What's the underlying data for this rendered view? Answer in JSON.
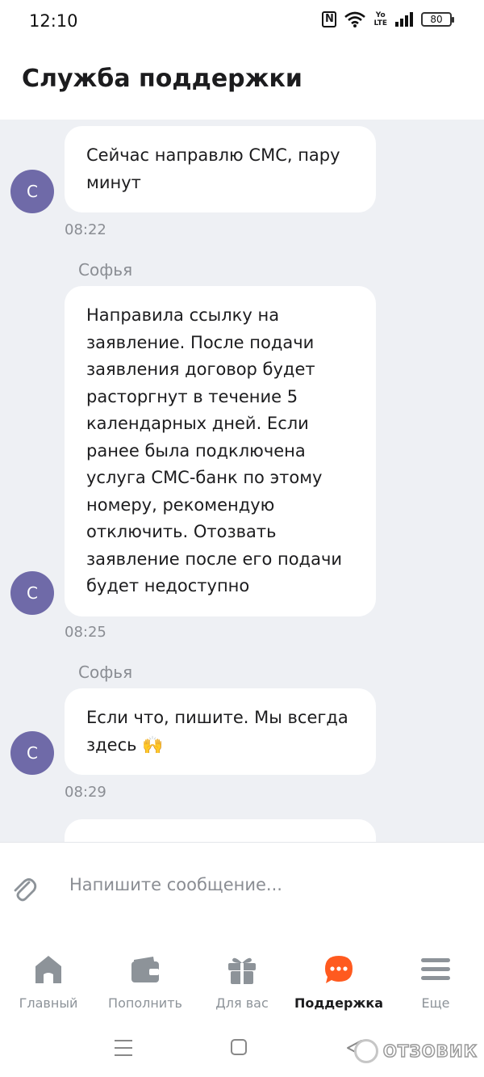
{
  "status_bar": {
    "time": "12:10",
    "volte_top": "Yo",
    "volte_bottom": "LTE",
    "battery": "80"
  },
  "header": {
    "title": "Служба поддержки"
  },
  "messages": [
    {
      "sender": "",
      "avatar": "С",
      "text": "Сейчас направлю СМС, пару минут",
      "time": "08:22"
    },
    {
      "sender": "Софья",
      "avatar": "С",
      "text": "Направила ссылку на заявление. После подачи заявления договор будет расторгнут в течение 5 календарных дней. Если ранее была подключена услуга СМС-банк по этому номеру, рекомендую отключить. Отозвать заявление после его подачи будет недоступно",
      "time": "08:25"
    },
    {
      "sender": "Софья",
      "avatar": "С",
      "text": "Если что, пишите. Мы всегда здесь 🙌",
      "time": "08:29"
    }
  ],
  "composer": {
    "placeholder": "Напишите сообщение..."
  },
  "bottom_nav": [
    {
      "label": "Главный",
      "icon": "home-icon",
      "active": false
    },
    {
      "label": "Пополнить",
      "icon": "wallet-icon",
      "active": false
    },
    {
      "label": "Для вас",
      "icon": "gift-icon",
      "active": false
    },
    {
      "label": "Поддержка",
      "icon": "chat-bubble-icon",
      "active": true
    },
    {
      "label": "Еще",
      "icon": "menu-icon",
      "active": false
    }
  ],
  "watermark": {
    "text": "ОТЗОВИК"
  },
  "colors": {
    "accent": "#ff5a1f",
    "avatar": "#6f6aa8",
    "chat_background": "#eef0f4",
    "nav_inactive": "#8d9399"
  }
}
